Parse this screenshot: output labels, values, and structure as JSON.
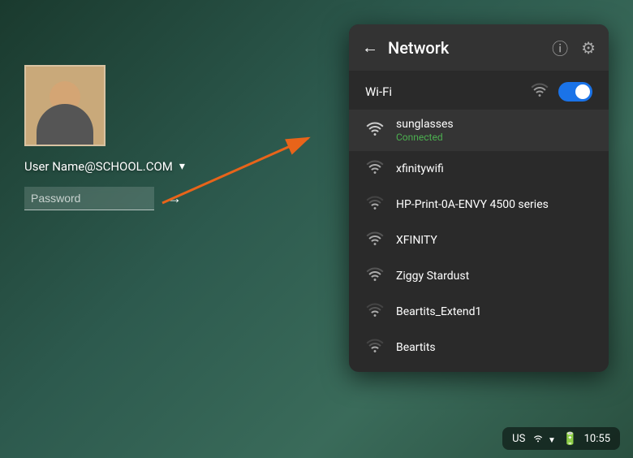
{
  "background": {
    "color_start": "#1a3a2e",
    "color_end": "#3a6b5a"
  },
  "login": {
    "username": "User Name@SCHOOL.COM",
    "password_placeholder": "Password",
    "submit_arrow": "→",
    "dropdown_arrow": "▾"
  },
  "network_panel": {
    "back_icon": "←",
    "title": "Network",
    "info_icon": "ⓘ",
    "settings_icon": "⚙",
    "wifi_section_label": "Wi-Fi",
    "toggle_state": "on",
    "networks": [
      {
        "name": "sunglasses",
        "status": "Connected",
        "signal": 4,
        "connected": true
      },
      {
        "name": "xfinitywifi",
        "status": "",
        "signal": 3,
        "connected": false
      },
      {
        "name": "HP-Print-0A-ENVY 4500 series",
        "status": "",
        "signal": 2,
        "connected": false
      },
      {
        "name": "XFINITY",
        "status": "",
        "signal": 3,
        "connected": false
      },
      {
        "name": "Ziggy Stardust",
        "status": "",
        "signal": 3,
        "connected": false
      },
      {
        "name": "Beartits_Extend1",
        "status": "",
        "signal": 2,
        "connected": false
      },
      {
        "name": "Beartits",
        "status": "",
        "signal": 2,
        "connected": false
      }
    ]
  },
  "taskbar": {
    "locale": "US",
    "wifi_icon": "▼",
    "battery_icon": "🔋",
    "time": "10:55"
  }
}
